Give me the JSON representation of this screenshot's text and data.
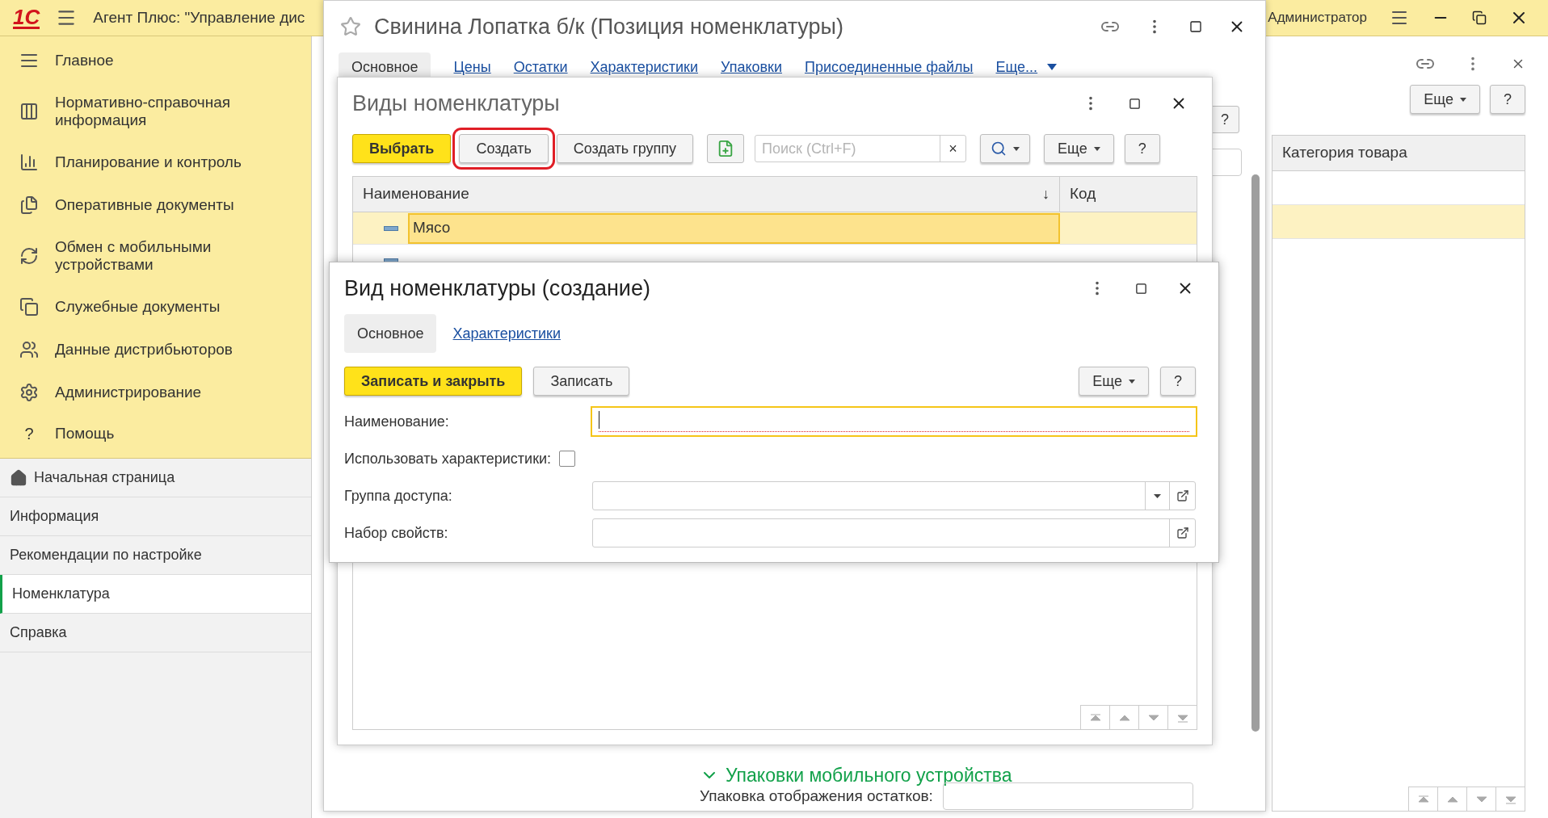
{
  "app_bar": {
    "logo": "1С",
    "title": "Агент Плюс: \"Управление дис",
    "user": "Администратор"
  },
  "sections": [
    {
      "label": "Главное"
    },
    {
      "label": "Нормативно-справочная информация"
    },
    {
      "label": "Планирование и контроль"
    },
    {
      "label": "Оперативные документы"
    },
    {
      "label": "Обмен с мобильными устройствами"
    },
    {
      "label": "Служебные документы"
    },
    {
      "label": "Данные дистрибьюторов"
    },
    {
      "label": "Администрирование"
    },
    {
      "label": "Помощь",
      "glyph": "?"
    }
  ],
  "nav_links": [
    {
      "label": "Начальная страница",
      "selected": false
    },
    {
      "label": "Информация",
      "selected": false
    },
    {
      "label": "Рекомендации по настройке",
      "selected": false
    },
    {
      "label": "Номенклатура",
      "selected": true
    },
    {
      "label": "Справка",
      "selected": false
    }
  ],
  "back_window": {
    "more": "Еще",
    "help": "?",
    "column": "Категория товара",
    "rows": [
      {
        "selected": false
      },
      {
        "selected": true
      }
    ]
  },
  "item_window": {
    "title": "Свинина Лопатка б/к (Позиция номенклатуры)",
    "tabs": [
      {
        "label": "Основное",
        "selected": true
      },
      {
        "label": "Цены",
        "selected": false
      },
      {
        "label": "Остатки",
        "selected": false
      },
      {
        "label": "Характеристики",
        "selected": false
      },
      {
        "label": "Упаковки",
        "selected": false
      },
      {
        "label": "Присоединенные файлы",
        "selected": false
      },
      {
        "label": "Еще...",
        "selected": false
      }
    ],
    "help": "?",
    "group": {
      "title": "Упаковки мобильного устройства",
      "expanded": true
    },
    "field_label": "Упаковка отображения остатков:"
  },
  "kinds_dialog": {
    "title": "Виды номенклатуры",
    "buttons": [
      {
        "kind": "primary",
        "label": "Выбрать",
        "annotated": false
      },
      {
        "kind": "normal",
        "label": "Создать",
        "annotated": true
      },
      {
        "kind": "normal",
        "label": "Создать группу",
        "annotated": false
      }
    ],
    "search": {
      "placeholder": "Поиск (Ctrl+F)",
      "clear": "×"
    },
    "more": "Еще",
    "help": "?",
    "columns": [
      {
        "label": "Наименование",
        "sort": "↓"
      },
      {
        "label": "Код"
      }
    ],
    "rows": [
      {
        "name": "Мясо",
        "selected": true
      },
      {
        "selected": false
      }
    ]
  },
  "create_dialog": {
    "title": "Вид номенклатуры (создание)",
    "tabs": [
      {
        "label": "Основное",
        "selected": true
      },
      {
        "label": "Характеристики",
        "selected": false
      }
    ],
    "save_close": "Записать и закрыть",
    "save": "Записать",
    "more": "Еще",
    "help": "?",
    "fields": [
      {
        "kind": "text",
        "label": "Наименование:",
        "focused": true
      },
      {
        "kind": "checkbox",
        "label": "Использовать характеристики:",
        "checked": false
      },
      {
        "kind": "select",
        "label": "Группа доступа:"
      },
      {
        "kind": "lookup",
        "label": "Набор свойств:"
      }
    ]
  }
}
